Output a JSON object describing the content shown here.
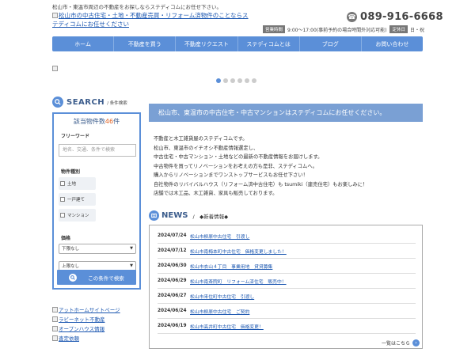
{
  "header": {
    "tagline": "松山市・東温市周辺の不動産をお探しならステディコムにお任せ下さい。",
    "logo_alt": "松山市の中古住宅・土地・不動産売買・リフォーム済物件のことならステディコムにお任せください",
    "phone_icon": "phone-icon",
    "phone": "089-916-6668",
    "hours_tag": "営業時間",
    "hours": "9:00～17:00(事前予約の場合時間外対応可能)",
    "closed_tag": "定休日",
    "closed": "日・祝"
  },
  "nav": {
    "items": [
      "ホーム",
      "不動産を買う",
      "不動産リクエスト",
      "ステディコムとは",
      "ブログ",
      "お問い合わせ"
    ]
  },
  "slider": {
    "dot_count": 6,
    "active_index": 0
  },
  "search": {
    "title": "SEARCH",
    "subtitle": "/ 条件検索",
    "count_prefix": "該当物件数",
    "count": "46",
    "count_suffix": "件",
    "keyword_label": "フリーワード",
    "keyword_placeholder": "地名、交通、条件で検索",
    "type_label": "物件種別",
    "types": [
      "土地",
      "一戸建て",
      "マンション"
    ],
    "price_label": "価格",
    "price_min": "下限なし",
    "price_max": "上限なし",
    "button": "この条件で検索"
  },
  "side_links": [
    "アットホームサイトページ",
    "ラビーネット不動産",
    "オープンハウス情報",
    "査定依頼"
  ],
  "main": {
    "banner": "松山市、東温市の中古住宅・中古マンションはステディコムにお任せください。",
    "intro": [
      "不動産と木工雑貨屋のステディコムです。",
      "松山市、東温市のイチオシ不動産情報選定し、",
      "中古住宅・中古マンション・土地などの最新の不動産情報をお届けします。",
      "中古物件を買ってリノベーションをお考えの方も是非、ステディコムへ。",
      "購入からリノベーションまでワンストップサービスもお任せ下さい！",
      "自社物件のリバイバルハウス（リフォーム済中古住宅）も tsumiki（建売住宅）もお楽しみに！",
      "店舗では木工品、木工雑貨、家具も販売しております。"
    ]
  },
  "news": {
    "title": "NEWS",
    "subtitle": "/　◆新着情報◆",
    "items": [
      {
        "date": "2024/07/24",
        "text": "松山市柳原中古住宅　引渡し"
      },
      {
        "date": "2024/07/12",
        "text": "松山市南梅本町中古住宅　価格変更しました！"
      },
      {
        "date": "2024/06/30",
        "text": "松山市衣山４丁目　事業用地　貸貸募集"
      },
      {
        "date": "2024/06/29",
        "text": "松山市南斎院町　リフォーム済住宅　販売中！"
      },
      {
        "date": "2024/06/27",
        "text": "松山市来住町中古住宅　引渡し"
      },
      {
        "date": "2024/06/24",
        "text": "松山市柳原中古住宅　ご契約"
      },
      {
        "date": "2024/06/19",
        "text": "松山市高井町中古住宅　価格変更！"
      }
    ],
    "more": "一覧はこちら",
    "more_icon": "chevron-right-icon"
  }
}
